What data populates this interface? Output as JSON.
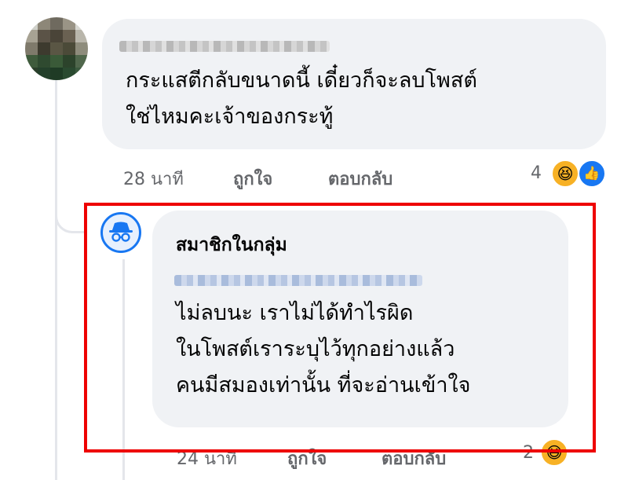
{
  "comment": {
    "lines": [
      "กระแสตีกลับขนาดนี้ เดี๋ยวก็จะลบโพสต์",
      "ใช่ไหมคะเจ้าของกระทู้"
    ],
    "time": "28 นาที",
    "like_label": "ถูกใจ",
    "reply_label": "ตอบกลับ",
    "reaction_count": "4",
    "reaction_icons": [
      "haha-icon",
      "like-icon"
    ]
  },
  "reply": {
    "author": "สมาชิกในกลุ่ม",
    "lines": [
      "ไม่ลบนะ เราไม่ได้ทำไรผิด",
      "ในโพสต์เราระบุไว้ทุกอย่างแล้ว",
      "คนมีสมองเท่านั้น ที่จะอ่านเข้าใจ"
    ],
    "time": "24 นาที",
    "like_label": "ถูกใจ",
    "reply_label": "ตอบกลับ",
    "reaction_count": "2",
    "reaction_icons": [
      "haha-icon"
    ]
  },
  "colors": {
    "bubble": "#f0f2f5",
    "meta_text": "#65676b",
    "highlight": "#ee0000",
    "accent": "#1877f2"
  }
}
